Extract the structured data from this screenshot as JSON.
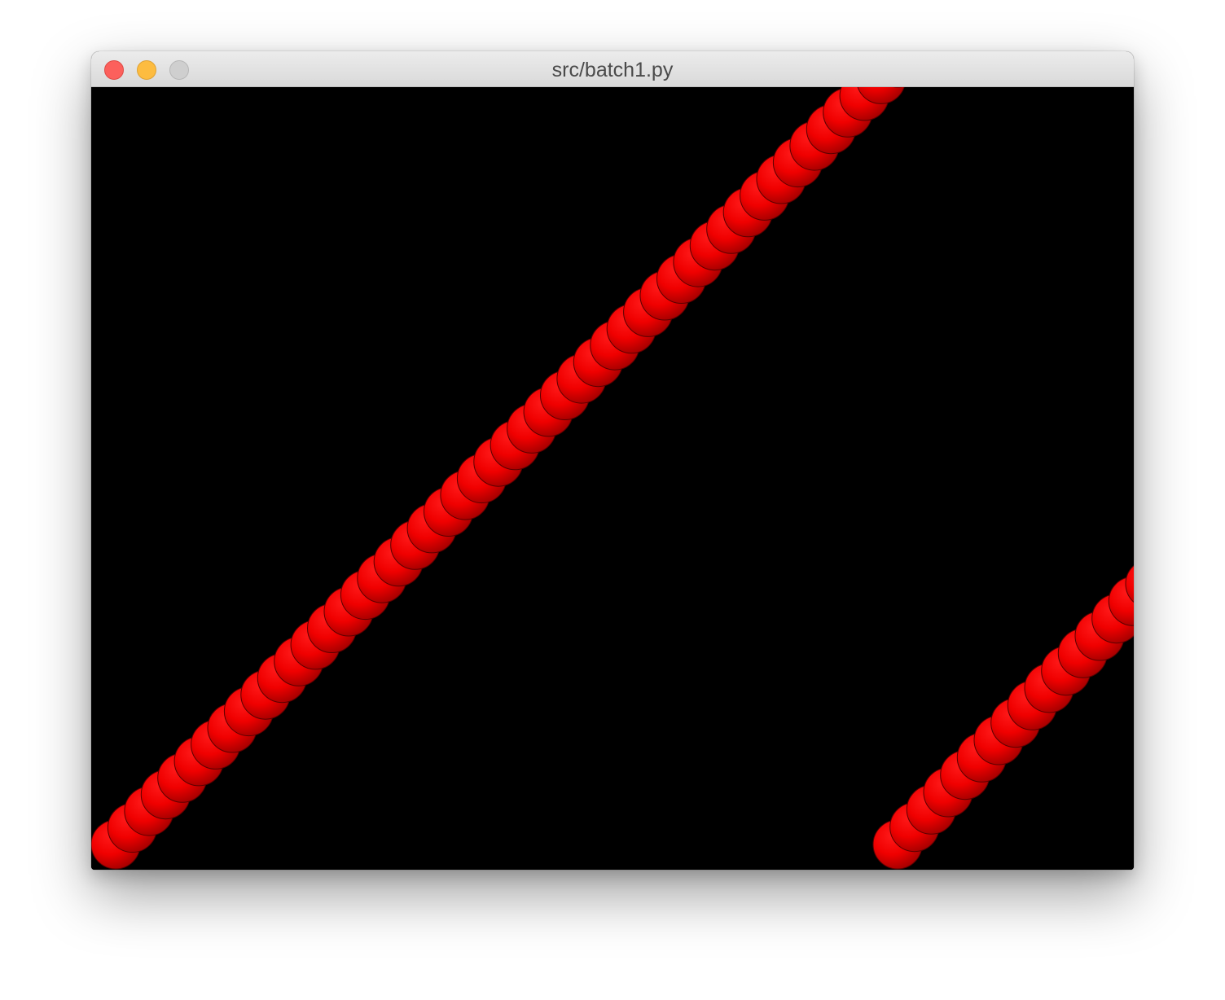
{
  "window": {
    "title": "src/batch1.py"
  },
  "canvas": {
    "background_color": "#000000",
    "ball_color": "#ee0000"
  }
}
